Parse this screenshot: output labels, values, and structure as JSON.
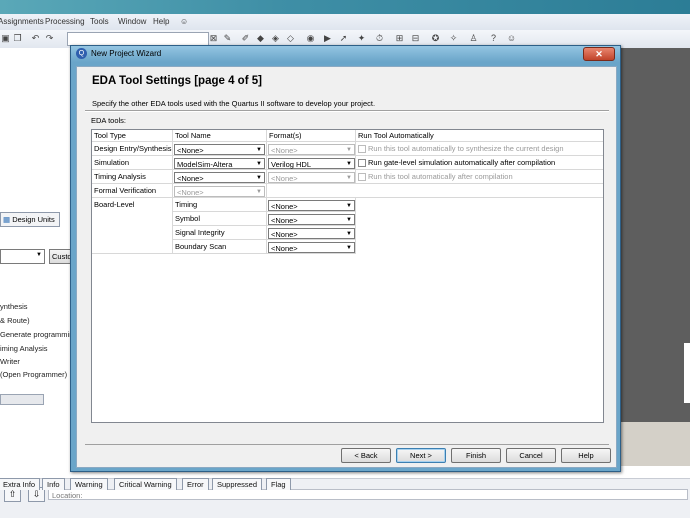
{
  "app": {
    "menus": [
      "Assignments",
      "Processing",
      "Tools",
      "Window",
      "Help"
    ],
    "left_tab": "Design Units",
    "left_button": "Custo",
    "left_items": [
      "ynthesis",
      "& Route)",
      "Generate programming",
      "iming Analysis",
      "Writer",
      "(Open Programmer)"
    ],
    "bottom_tabs": [
      "Extra Info",
      "Info",
      "Warning",
      "Critical Warning",
      "Error",
      "Suppressed",
      "Flag"
    ],
    "location_label": "Location:"
  },
  "dialog": {
    "title": "New Project Wizard",
    "close_glyph": "✕",
    "heading": "EDA Tool Settings [page 4 of 5]",
    "subtitle": "Specify the other EDA tools used with the Quartus II software to develop your project.",
    "eda_label": "EDA tools:",
    "columns": [
      "Tool Type",
      "Tool Name",
      "Format(s)",
      "Run Tool Automatically"
    ],
    "rows": [
      {
        "type": "Design Entry/Synthesis",
        "name": "<None>",
        "name_enabled": true,
        "format": "<None>",
        "format_enabled": false,
        "run": "Run this tool automatically to synthesize the current design",
        "run_enabled": false
      },
      {
        "type": "Simulation",
        "name": "ModelSim-Altera",
        "name_enabled": true,
        "format": "Verilog HDL",
        "format_enabled": true,
        "run": "Run gate-level simulation automatically after compilation",
        "run_enabled": true
      },
      {
        "type": "Timing Analysis",
        "name": "<None>",
        "name_enabled": true,
        "format": "<None>",
        "format_enabled": false,
        "run": "Run this tool automatically after compilation",
        "run_enabled": false
      },
      {
        "type": "Formal Verification",
        "name": "<None>",
        "name_enabled": false
      }
    ],
    "board_level": {
      "type": "Board-Level",
      "rows": [
        {
          "name": "Timing",
          "format": "<None>"
        },
        {
          "name": "Symbol",
          "format": "<None>"
        },
        {
          "name": "Signal Integrity",
          "format": "<None>"
        },
        {
          "name": "Boundary Scan",
          "format": "<None>"
        }
      ]
    },
    "buttons": {
      "back": "< Back",
      "next": "Next >",
      "finish": "Finish",
      "cancel": "Cancel",
      "help": "Help"
    }
  }
}
